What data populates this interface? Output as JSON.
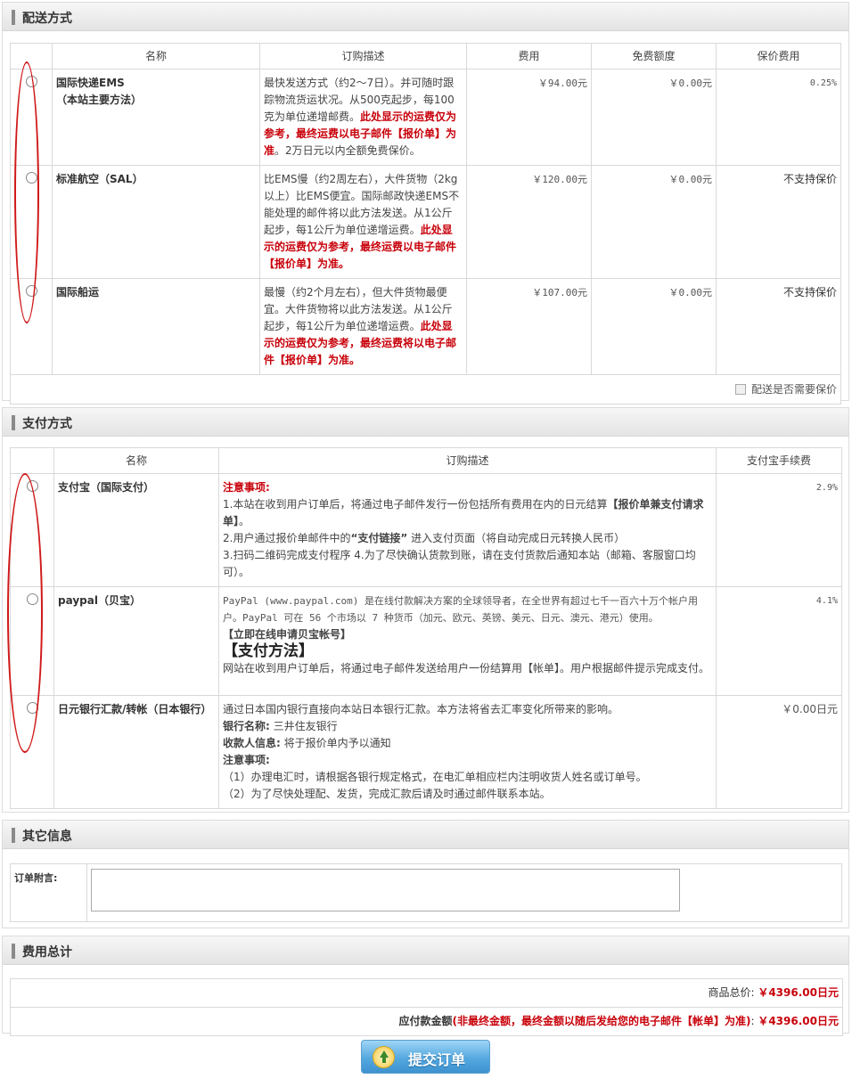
{
  "shipping": {
    "section_title": "配送方式",
    "headers": [
      "名称",
      "订购描述",
      "费用",
      "免费额度",
      "保价费用"
    ],
    "rows": [
      {
        "name_line1": "国际快递EMS",
        "name_line2": "（本站主要方法）",
        "desc_plain": "最快发送方式（约2～7日）。并可随时跟踪物流货运状况。从500克起步，每100克为单位递增邮费。",
        "desc_red": "此处显示的运费仅为参考，最终运费以电子邮件【报价单】为准",
        "desc_tail": "。2万日元以内全额免费保价。",
        "fee": "￥94.00元",
        "free": "￥0.00元",
        "insurance": "0.25%"
      },
      {
        "name_line1": "标准航空（SAL）",
        "name_line2": "",
        "desc_plain": "比EMS慢（约2周左右），大件货物（2kg以上）比EMS便宜。国际邮政快递EMS不能处理的邮件将以此方法发送。从1公斤起步，每1公斤为单位递增运费。",
        "desc_red": "此处显示的运费仅为参考，最终运费以电子邮件【报价单】为准。",
        "desc_tail": "",
        "fee": "￥120.00元",
        "free": "￥0.00元",
        "insurance": "不支持保价"
      },
      {
        "name_line1": "国际船运",
        "name_line2": "",
        "desc_plain": "最慢（约2个月左右），但大件货物最便宜。大件货物将以此方法发送。从1公斤起步，每1公斤为单位递增运费。",
        "desc_red": "此处显示的运费仅为参考，最终运费将以电子邮件【报价单】为准。",
        "desc_tail": "",
        "fee": "￥107.00元",
        "free": "￥0.00元",
        "insurance": "不支持保价"
      }
    ],
    "insure_label": "配送是否需要保价"
  },
  "payment": {
    "section_title": "支付方式",
    "headers": [
      "名称",
      "订购描述",
      "支付宝手续费"
    ],
    "alipay": {
      "name": "支付宝（国际支付）",
      "notice": "注意事项:",
      "l1": "1.本站在收到用户订单后，将通过电子邮件发行一份包括所有费用在内的日元结算",
      "l1b": "【报价单兼支付请求单】",
      "l1c": "。",
      "l2a": "2.用户通过报价单邮件中的",
      "l2b": "“支付链接”",
      "l2c": "进入支付页面（将自动完成日元转换人民币）",
      "l3": "3.扫码二维码完成支付程序  4.为了尽快确认货款到账，请在支付货款后通知本站（邮箱、客服窗口均可）。",
      "fee": "2.9%"
    },
    "paypal": {
      "name": "paypal（贝宝）",
      "text": "PayPal (www.paypal.com) 是在线付款解决方案的全球领导者，在全世界有超过七千一百六十万个帐户用户。PayPal 可在 56 个市场以 7 种货币（加元、欧元、英镑、美元、日元、澳元、港元）使用。",
      "link": "【立即在线申请贝宝帐号】",
      "method": "【支付方法】",
      "tail": "网站在收到用户订单后，将通过电子邮件发送给用户一份结算用【帐单】。用户根据邮件提示完成支付。",
      "fee": "4.1%"
    },
    "bank": {
      "name": "日元银行汇款/转帐（日本银行）",
      "l1": "通过日本国内银行直接向本站日本银行汇款。本方法将省去汇率变化所带来的影响。",
      "bank_label": "银行名称:",
      "bank_value": "三井住友银行",
      "payee_label": "收款人信息:",
      "payee_value": "将于报价单内予以通知",
      "notice": "注意事项:",
      "n1": "（1）办理电汇时，请根据各银行规定格式，在电汇单相应栏内注明收货人姓名或订单号。",
      "n2": "（2）为了尽快处理配、发货，完成汇款后请及时通过邮件联系本站。",
      "fee": "￥0.00日元"
    }
  },
  "other": {
    "section_title": "其它信息",
    "note_label": "订单附言:",
    "note_value": ""
  },
  "total": {
    "section_title": "费用总计",
    "goods_label": "商品总价:",
    "goods_value": "￥4396.00日元",
    "due_label": "应付款金额",
    "due_note": "(非最终金额，最终金额以随后发给您的电子邮件【帐单】为准)",
    "due_colon": ":",
    "due_value": "￥4396.00日元"
  },
  "submit_label": "提交订单",
  "colors": {
    "accent_red": "#c8000a",
    "button_blue": "#55a9e0",
    "annotation_red": "#d01818"
  }
}
